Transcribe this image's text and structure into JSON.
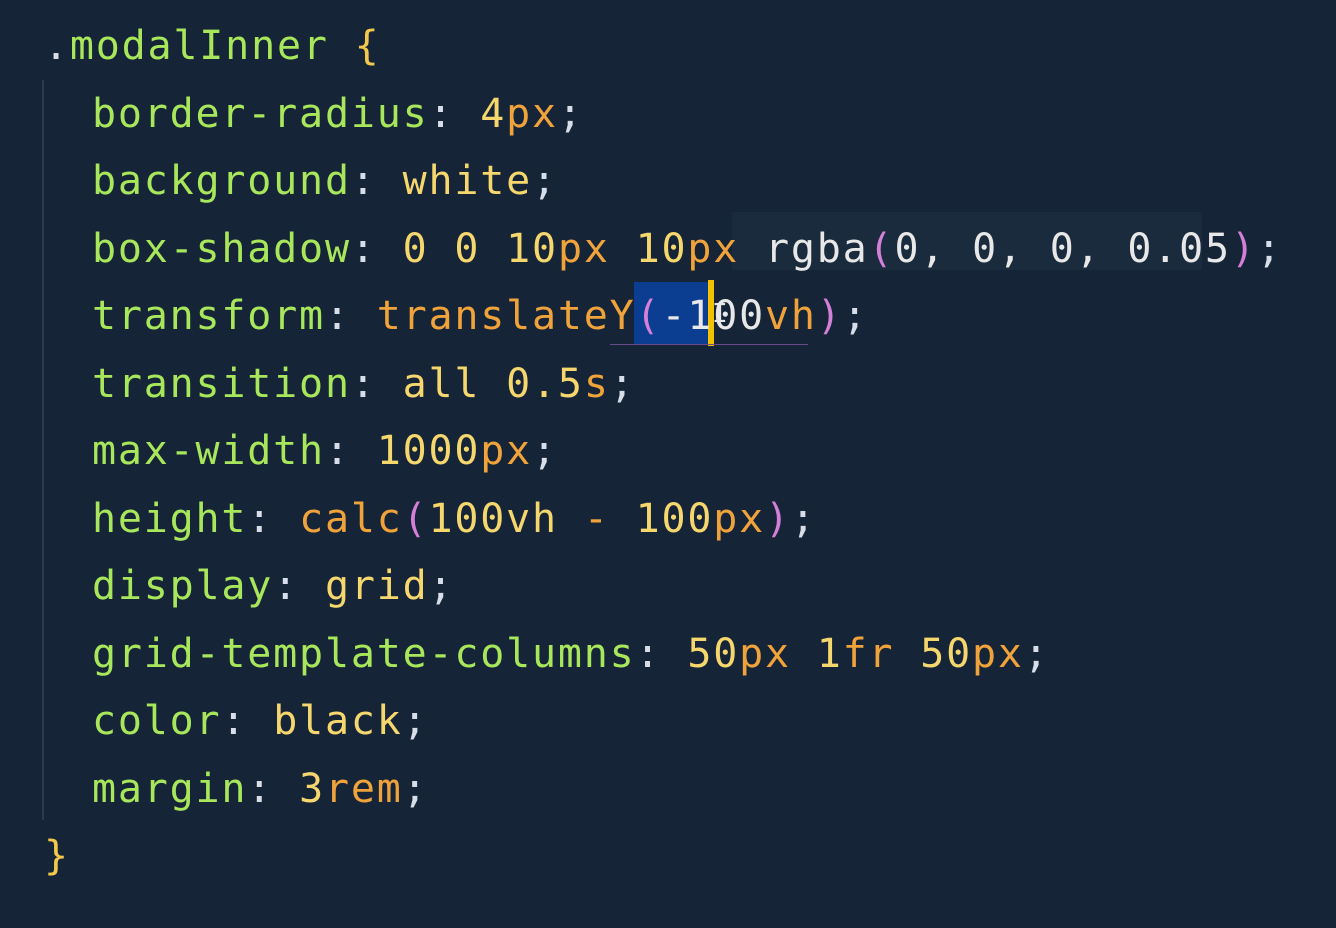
{
  "colors": {
    "background": "#152437",
    "property": "#a8e65b",
    "number": "#f5d76e",
    "unit": "#f0a33a",
    "function": "#f0a33a",
    "paren": "#d47fd8",
    "selection": "#0b3d91",
    "caret": "#f2c200"
  },
  "code": {
    "selector": {
      "dot": ".",
      "name": "modalInner",
      "open_brace": "{"
    },
    "decl1": {
      "prop": "border-radius",
      "colon": ":",
      "num": "4",
      "unit": "px",
      "semi": ";"
    },
    "decl2": {
      "prop": "background",
      "colon": ":",
      "value": "white",
      "semi": ";"
    },
    "decl3": {
      "prop": "box-shadow",
      "colon": ":",
      "n1": "0",
      "n2": "0",
      "n3": "10",
      "u3": "px",
      "n4": "10",
      "u4": "px",
      "func": "rgba",
      "po": "(",
      "args": "0, 0, 0, 0.05",
      "pc": ")",
      "semi": ";"
    },
    "decl4": {
      "prop": "transform",
      "colon": ":",
      "func": "translateY",
      "po": "(",
      "selected": "-10",
      "after_caret": "0",
      "unit": "vh",
      "pc": ")",
      "semi": ";"
    },
    "decl5": {
      "prop": "transition",
      "colon": ":",
      "value": "all",
      "num": "0.5",
      "unit": "s",
      "semi": ";"
    },
    "decl6": {
      "prop": "max-width",
      "colon": ":",
      "num": "1000",
      "unit": "px",
      "semi": ";"
    },
    "decl7": {
      "prop": "height",
      "colon": ":",
      "func": "calc",
      "po": "(",
      "n1": "100",
      "u1": "vh",
      "op": "-",
      "n2": "100",
      "u2": "px",
      "pc": ")",
      "semi": ";"
    },
    "decl8": {
      "prop": "display",
      "colon": ":",
      "value": "grid",
      "semi": ";"
    },
    "decl9": {
      "prop": "grid-template-columns",
      "colon": ":",
      "n1": "50",
      "u1": "px",
      "n2": "1",
      "u2": "fr",
      "n3": "50",
      "u3": "px",
      "semi": ";"
    },
    "decl10": {
      "prop": "color",
      "colon": ":",
      "value": "black",
      "semi": ";"
    },
    "decl11": {
      "prop": "margin",
      "colon": ":",
      "num": "3",
      "unit": "rem",
      "semi": ";"
    },
    "close_brace": "}"
  }
}
